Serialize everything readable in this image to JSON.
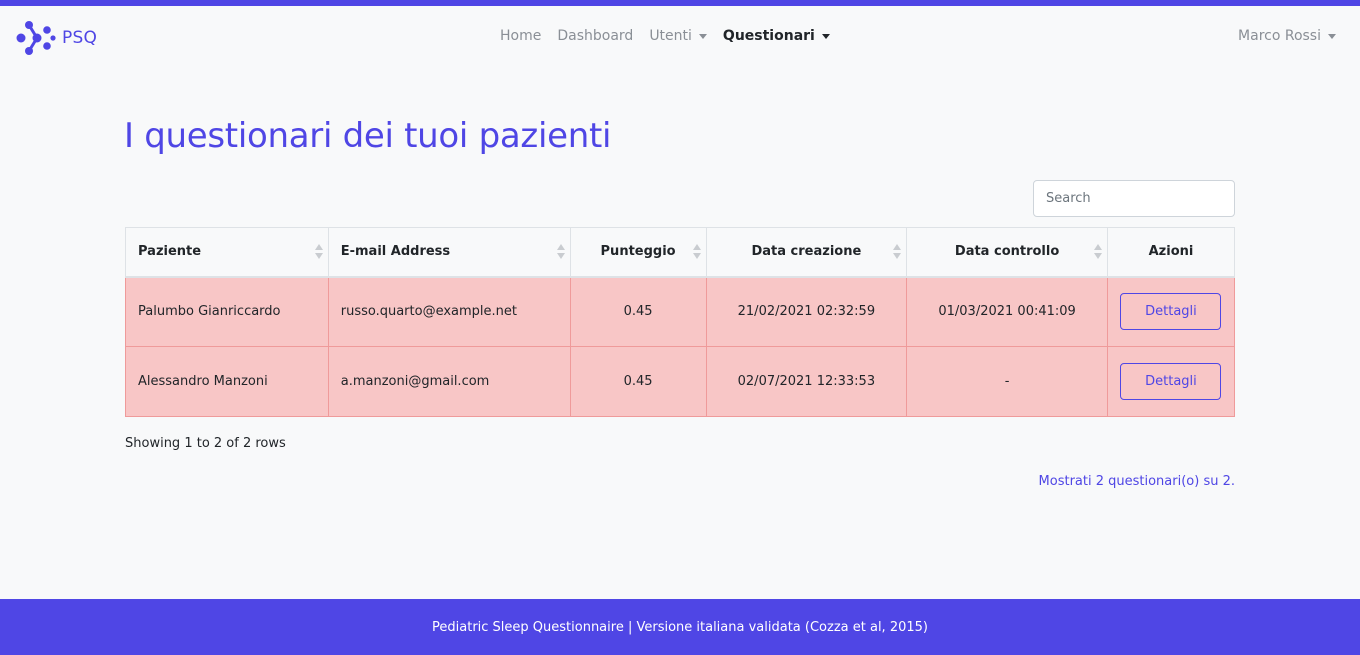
{
  "colors": {
    "accent": "#4f46e5",
    "row_danger": "#f8c6c6",
    "row_border": "#ef9a9a"
  },
  "brand": {
    "name": "PSQ",
    "logo_icon": "psq-molecule-logo"
  },
  "nav": {
    "items": [
      {
        "label": "Home",
        "active": false,
        "dropdown": false
      },
      {
        "label": "Dashboard",
        "active": false,
        "dropdown": false
      },
      {
        "label": "Utenti",
        "active": false,
        "dropdown": true
      },
      {
        "label": "Questionari",
        "active": true,
        "dropdown": true
      }
    ],
    "user": "Marco Rossi"
  },
  "main": {
    "title": "I questionari dei tuoi pazienti",
    "search_placeholder": "Search",
    "table": {
      "columns": [
        "Paziente",
        "E-mail Address",
        "Punteggio",
        "Data creazione",
        "Data controllo",
        "Azioni"
      ],
      "rows": [
        {
          "patient": "Palumbo Gianriccardo",
          "email": "russo.quarto@example.net",
          "score": "0.45",
          "created": "21/02/2021 02:32:59",
          "checked": "01/03/2021 00:41:09",
          "action": "Dettagli"
        },
        {
          "patient": "Alessandro Manzoni",
          "email": "a.manzoni@gmail.com",
          "score": "0.45",
          "created": "02/07/2021 12:33:53",
          "checked": "-",
          "action": "Dettagli"
        }
      ]
    },
    "rows_info": "Showing 1 to 2 of 2 rows",
    "total_info": "Mostrati 2 questionari(o) su 2."
  },
  "footer": {
    "text": "Pediatric Sleep Questionnaire | Versione italiana validata (Cozza et al, 2015)"
  }
}
